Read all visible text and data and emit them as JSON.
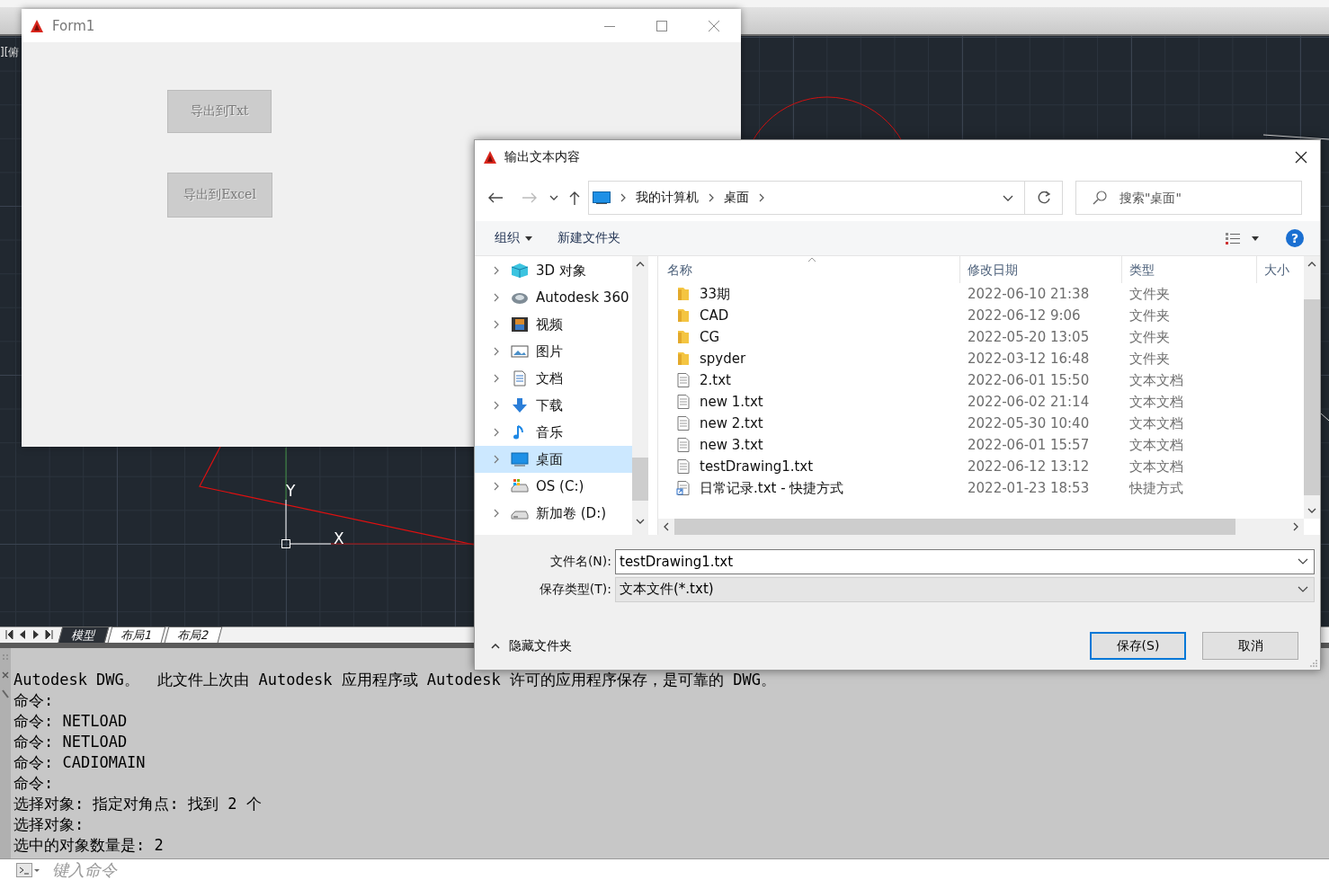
{
  "cad": {
    "viewport_label": "][俯",
    "ucs": {
      "x_label": "X",
      "y_label": "Y"
    },
    "layout_tabs": [
      {
        "label": "模型",
        "selected": true
      },
      {
        "label": "布局1",
        "selected": false
      },
      {
        "label": "布局2",
        "selected": false
      }
    ],
    "command_history": [
      "Autodesk DWG。  此文件上次由 Autodesk 应用程序或 Autodesk 许可的应用程序保存，是可靠的 DWG。",
      "命令:",
      "命令: NETLOAD",
      "命令: NETLOAD",
      "命令: CADIOMAIN",
      "命令:",
      "选择对象: 指定对角点: 找到 2 个",
      "选择对象:",
      "选中的对象数量是: 2"
    ],
    "command_input": {
      "placeholder": "键入命令"
    }
  },
  "form1": {
    "title": "Form1",
    "buttons": [
      {
        "label": "导出到Txt",
        "disabled": true
      },
      {
        "label": "导出到Excel",
        "disabled": true
      }
    ]
  },
  "save_dialog": {
    "title": "输出文本内容",
    "breadcrumb": [
      "我的计算机",
      "桌面"
    ],
    "search": {
      "placeholder": "搜索\"桌面\""
    },
    "toolbar": [
      "组织",
      "新建文件夹"
    ],
    "help": "?",
    "nav_tree": [
      {
        "label": "3D 对象",
        "kind": "objects3d",
        "selected": false
      },
      {
        "label": "Autodesk 360",
        "kind": "cloud",
        "selected": false
      },
      {
        "label": "视频",
        "kind": "video",
        "selected": false
      },
      {
        "label": "图片",
        "kind": "picture",
        "selected": false
      },
      {
        "label": "文档",
        "kind": "document",
        "selected": false
      },
      {
        "label": "下载",
        "kind": "download",
        "selected": false
      },
      {
        "label": "音乐",
        "kind": "music",
        "selected": false
      },
      {
        "label": "桌面",
        "kind": "desktop",
        "selected": true
      },
      {
        "label": "OS (C:)",
        "kind": "system_drive",
        "selected": false
      },
      {
        "label": "新加卷 (D:)",
        "kind": "drive",
        "selected": false
      }
    ],
    "columns": [
      "名称",
      "修改日期",
      "类型",
      "大小"
    ],
    "files": [
      {
        "name": "33期",
        "modified": "2022-06-10 21:38",
        "type": "文件夹",
        "kind": "folder"
      },
      {
        "name": "CAD",
        "modified": "2022-06-12 9:06",
        "type": "文件夹",
        "kind": "folder"
      },
      {
        "name": "CG",
        "modified": "2022-05-20 13:05",
        "type": "文件夹",
        "kind": "folder"
      },
      {
        "name": "spyder",
        "modified": "2022-03-12 16:48",
        "type": "文件夹",
        "kind": "folder"
      },
      {
        "name": "2.txt",
        "modified": "2022-06-01 15:50",
        "type": "文本文档",
        "kind": "text"
      },
      {
        "name": "new 1.txt",
        "modified": "2022-06-02 21:14",
        "type": "文本文档",
        "kind": "text"
      },
      {
        "name": "new 2.txt",
        "modified": "2022-05-30 10:40",
        "type": "文本文档",
        "kind": "text"
      },
      {
        "name": "new 3.txt",
        "modified": "2022-06-01 15:57",
        "type": "文本文档",
        "kind": "text"
      },
      {
        "name": "testDrawing1.txt",
        "modified": "2022-06-12 13:12",
        "type": "文本文档",
        "kind": "text"
      },
      {
        "name": "日常记录.txt - 快捷方式",
        "modified": "2022-01-23 18:53",
        "type": "快捷方式",
        "kind": "shortcut"
      }
    ],
    "file_name": {
      "label": "文件名(N):",
      "value": "testDrawing1.txt"
    },
    "file_type": {
      "label": "保存类型(T):",
      "value": "文本文件(*.txt)"
    },
    "hide_folders": "隐藏文件夹",
    "buttons": [
      {
        "label": "保存(S)",
        "default": true
      },
      {
        "label": "取消",
        "default": false
      }
    ]
  }
}
